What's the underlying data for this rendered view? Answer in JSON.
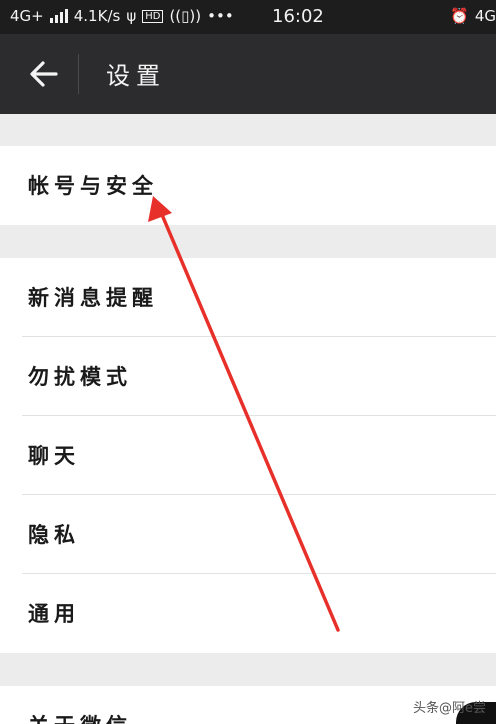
{
  "status_bar": {
    "network": "4G+",
    "speed": "4.1K/s",
    "usb_symbol": "ψ",
    "hd_symbol": "HD",
    "more": "•••",
    "time": "16:02",
    "right_network": "4G"
  },
  "header": {
    "title": "设置"
  },
  "settings": {
    "account_security": "帐号与安全",
    "new_message_alerts": "新消息提醒",
    "do_not_disturb": "勿扰模式",
    "chat": "聊天",
    "privacy": "隐私",
    "general": "通用",
    "about": "关于微信"
  },
  "watermark": "头条@阿e尝",
  "colors": {
    "appbar": "#2c2c2e",
    "arrow": "#e8302a"
  }
}
